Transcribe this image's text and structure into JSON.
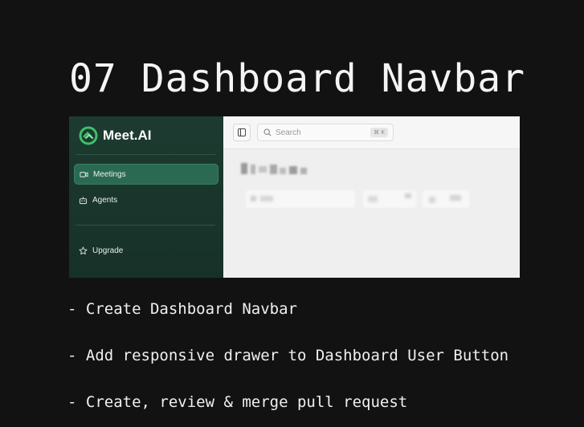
{
  "slide": {
    "title": "07 Dashboard Navbar"
  },
  "app": {
    "brand": "Meet.AI",
    "accent": "#2a6a52",
    "sidebar_bg": "#1d3b30",
    "nav": [
      {
        "label": "Meetings",
        "icon": "video-icon",
        "active": true
      },
      {
        "label": "Agents",
        "icon": "bot-icon",
        "active": false
      }
    ],
    "upgrade_label": "Upgrade",
    "search": {
      "placeholder": "Search",
      "shortcut": "⌘ K"
    }
  },
  "bullets": [
    "- Create Dashboard Navbar",
    "- Add responsive drawer to Dashboard User Button",
    "- Create, review & merge pull request"
  ]
}
